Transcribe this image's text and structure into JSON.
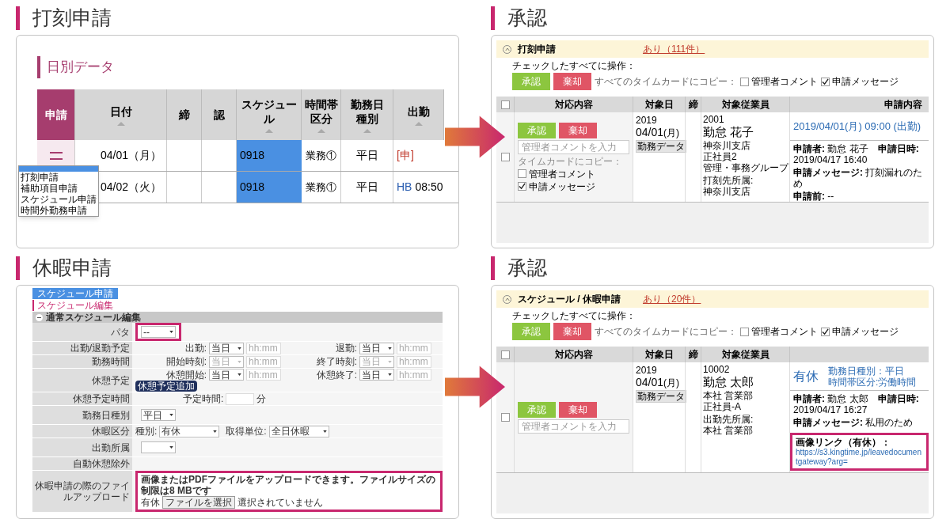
{
  "sections": [
    {
      "kind": "daily_table",
      "heading": "打刻申請",
      "title": "日別データ",
      "columns": [
        {
          "label": "申請",
          "sortable": false,
          "accent": true
        },
        {
          "label": "日付",
          "sortable": true,
          "accent": false
        },
        {
          "label": "締",
          "sortable": false,
          "accent": false
        },
        {
          "label": "認",
          "sortable": false,
          "accent": false
        },
        {
          "label": "スケジュール",
          "sortable": true,
          "accent": false
        },
        {
          "label": "時間帯区分",
          "sortable": true,
          "accent": false
        },
        {
          "label": "勤務日種別",
          "sortable": true,
          "accent": false
        },
        {
          "label": "出勤",
          "sortable": true,
          "accent": false
        }
      ],
      "rows": [
        {
          "date": "04/01（月）",
          "schedule": "0918",
          "time_zone": "業務①",
          "day_type": "平日",
          "clock_in": {
            "kind": "pending",
            "text": "[申]"
          }
        },
        {
          "date": "04/02（火）",
          "schedule": "0918",
          "time_zone": "業務①",
          "day_type": "平日",
          "clock_in": {
            "kind": "stamp",
            "prefix": "HB",
            "time": "08:50"
          }
        }
      ],
      "menu": [
        "打刻申請",
        "補助項目申請",
        "スケジュール申請",
        "時間外勤務申請"
      ]
    },
    {
      "kind": "approval",
      "heading": "承認",
      "title": "打刻申請",
      "count_link": "あり（111件）",
      "expanded": true,
      "bulk": {
        "label": "チェックしたすべてに操作：",
        "approve": "承認",
        "reject": "棄却",
        "copy_label": "すべてのタイムカードにコピー：",
        "checks": [
          {
            "label": "管理者コメント",
            "checked": false
          },
          {
            "label": "申請メッセージ",
            "checked": true
          }
        ]
      },
      "all_checked": false,
      "columns": [
        "対応内容",
        "対象日",
        "締",
        "対象従業員",
        "申請内容"
      ],
      "row": {
        "checked": false,
        "approve": "承認",
        "reject": "棄却",
        "comment_placeholder": "管理者コメントを入力",
        "copy_label": "タイムカードにコピー：",
        "checks": [
          {
            "label": "管理者コメント",
            "checked": false
          },
          {
            "label": "申請メッセージ",
            "checked": true
          }
        ],
        "year": "2019",
        "date": "04/01",
        "weekday": "(月)",
        "tag": "勤務データ",
        "employee": {
          "id": "2001",
          "name": "勤怠 花子",
          "details": [
            "神奈川支店",
            "正社員2",
            "管理・事務グループ"
          ],
          "affiliation_label": "打刻先所属:",
          "affiliation": "神奈川支店"
        },
        "request": {
          "headline": "2019/04/01(月) 09:00 (出勤)",
          "info": [
            "**申請者:** 勤怠 花子　**申請日時:** 2019/04/17 16:40",
            "**申請メッセージ:** 打刻漏れのため",
            "**申請前:** --"
          ]
        }
      }
    },
    {
      "kind": "form",
      "heading": "休暇申請",
      "tab": "スケジュール申請",
      "subtitle": "スケジュール編集",
      "section": "通常スケジュール編集",
      "expanded": true,
      "rows": [
        {
          "kind": "select",
          "label": "パタ",
          "value": "--",
          "highlighted": true
        },
        {
          "kind": "pair",
          "label": "出勤/退勤予定",
          "fields": [
            {
              "label": "出勤:",
              "select": "当日",
              "placeholder": "hh:mm",
              "disabled": false
            },
            {
              "label": "退勤:",
              "select": "当日",
              "placeholder": "hh:mm",
              "disabled": false
            }
          ]
        },
        {
          "kind": "pair",
          "label": "勤務時間",
          "fields": [
            {
              "label": "開始時刻:",
              "select": "当日",
              "placeholder": "hh:mm",
              "disabled": true
            },
            {
              "label": "終了時刻:",
              "select": "当日",
              "placeholder": "hh:mm",
              "disabled": true
            }
          ]
        },
        {
          "kind": "pair",
          "label": "休憩予定",
          "button": "休憩予定追加",
          "fields": [
            {
              "label": "休憩開始:",
              "select": "当日",
              "placeholder": "hh:mm",
              "disabled": false
            },
            {
              "label": "休憩終了:",
              "select": "当日",
              "placeholder": "hh:mm",
              "disabled": false
            }
          ]
        },
        {
          "kind": "minutes",
          "label": "休憩予定時間",
          "field_label": "予定時間:",
          "unit": "分"
        },
        {
          "kind": "select",
          "label": "勤務日種別",
          "value": "平日",
          "highlighted": false
        },
        {
          "kind": "leave",
          "label": "休暇区分",
          "fields": [
            {
              "label": "種別:",
              "select": "有休"
            },
            {
              "label": "取得単位:",
              "select": "全日休暇"
            }
          ]
        },
        {
          "kind": "select",
          "label": "出勤所属",
          "highlighted": false
        },
        {
          "kind": "label",
          "label": "自動休憩除外"
        },
        {
          "kind": "upload",
          "label": "休暇申請の際のファイルアップロード",
          "note": "画像またはPDFファイルをアップロードできます。ファイルサイズの制限は8 MBです",
          "file_label": "有休",
          "button": "ファイルを選択",
          "status": "選択されていません",
          "highlighted": true
        }
      ]
    },
    {
      "kind": "approval",
      "heading": "承認",
      "title": "スケジュール / 休暇申請",
      "count_link": "あり（20件）",
      "expanded": true,
      "bulk": {
        "label": "チェックしたすべてに操作：",
        "approve": "承認",
        "reject": "棄却",
        "copy_label": "すべてのタイムカードにコピー：",
        "checks": [
          {
            "label": "管理者コメント",
            "checked": false
          },
          {
            "label": "申請メッセージ",
            "checked": true
          }
        ]
      },
      "all_checked": false,
      "columns": [
        "対応内容",
        "対象日",
        "締",
        "対象従業員"
      ],
      "row": {
        "checked": false,
        "approve": "承認",
        "reject": "棄却",
        "comment_placeholder": "管理者コメントを入力",
        "year": "2019",
        "date": "04/01",
        "weekday": "(月)",
        "tag": "勤務データ",
        "employee": {
          "id": "10002",
          "name": "勤怠 太郎",
          "details": [
            "本社 営業部",
            "正社員-A"
          ],
          "affiliation_label": "出勤先所属:",
          "affiliation": "本社 営業部"
        },
        "request": {
          "headline": "有休",
          "sub": [
            "勤務日種別：平日",
            "時間帯区分:労働時間"
          ],
          "info": [
            "**申請者:** 勤怠 太郎　**申請日時:** 2019/04/17 16:27",
            "**申請メッセージ:** 私用のため"
          ],
          "link": {
            "label": "画像リンク（有休）：",
            "url": "https://s3.kingtime.jp/leavedocumentgateway?arg=",
            "highlighted": true
          }
        }
      }
    }
  ]
}
